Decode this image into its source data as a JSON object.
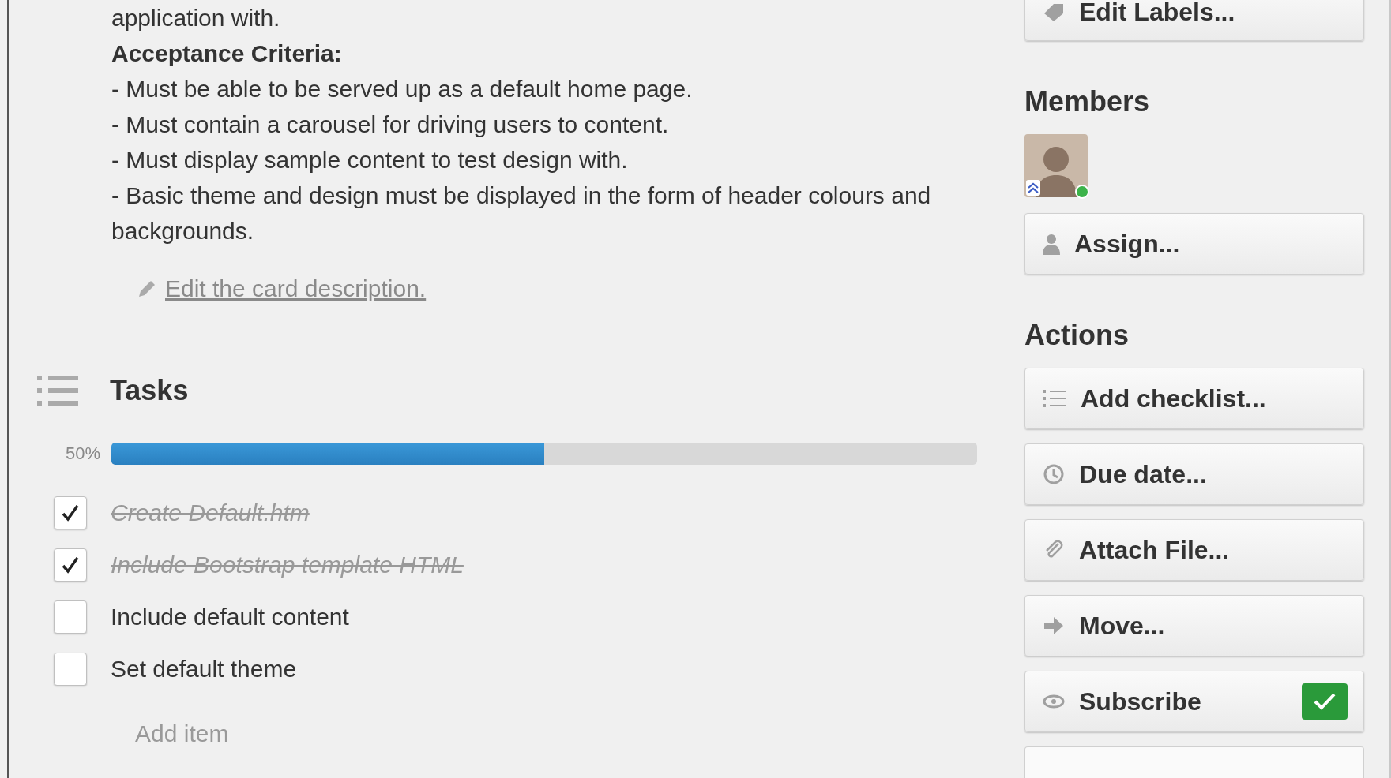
{
  "description": {
    "partial_line": "application with.",
    "heading": "Acceptance Criteria:",
    "lines": [
      "- Must be able to be served up as a default home page.",
      "- Must contain a carousel for driving users to content.",
      "- Must display sample content to test design with.",
      "- Basic theme and design must be displayed in the form of header colours and backgrounds."
    ],
    "edit_link": "Edit the card description."
  },
  "checklist": {
    "title": "Tasks",
    "percent": "50%",
    "level": 0.5,
    "items": [
      {
        "text": "Create Default.htm",
        "checked": true
      },
      {
        "text": "Include Bootstrap template HTML",
        "checked": true
      },
      {
        "text": "Include default content",
        "checked": false
      },
      {
        "text": "Set default theme",
        "checked": false
      }
    ],
    "add_item": "Add item"
  },
  "sidebar": {
    "top_button": "Edit Labels...",
    "members_heading": "Members",
    "member": {
      "online": true
    },
    "assign_button": "Assign...",
    "actions_heading": "Actions",
    "actions": [
      {
        "label": "Add checklist...",
        "kind": "button"
      },
      {
        "label": "Due date...",
        "kind": "button"
      },
      {
        "label": "Attach File...",
        "kind": "button"
      },
      {
        "label": "Move...",
        "kind": "button"
      },
      {
        "label": "Subscribe",
        "kind": "toggle",
        "checked": true
      }
    ]
  }
}
